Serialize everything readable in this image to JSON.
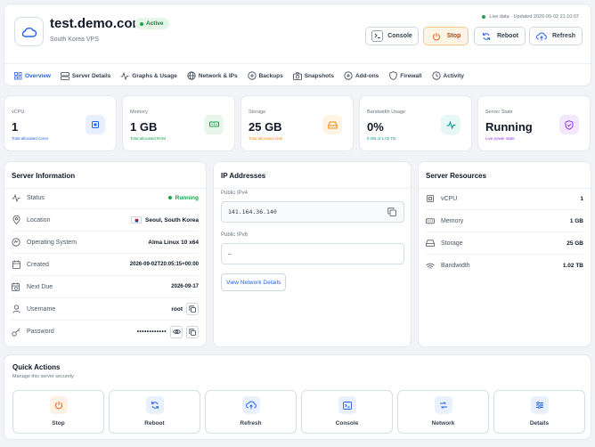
{
  "header": {
    "server_name": "test.demo.com",
    "status_badge": "Active",
    "subtitle": "South Korea VPS",
    "live_text": "Live data · Updated 2026-09-02 21:10:07",
    "buttons": {
      "console": "Console",
      "stop": "Stop",
      "reboot": "Reboot",
      "refresh": "Refresh"
    }
  },
  "tabs": [
    "Overview",
    "Server Details",
    "Graphs & Usage",
    "Network & IPs",
    "Backups",
    "Snapshots",
    "Add-ons",
    "Firewall",
    "Activity"
  ],
  "stats": [
    {
      "label": "vCPU",
      "value": "1",
      "sub": "Total allocated cores",
      "color": "#2563eb",
      "bg": "#e8f0fe"
    },
    {
      "label": "Memory",
      "value": "1 GB",
      "sub": "Total allocated RAM",
      "color": "#16a34a",
      "bg": "#e7f7ec"
    },
    {
      "label": "Storage",
      "value": "25 GB",
      "sub": "Total allocated disk",
      "color": "#ea8a0c",
      "bg": "#fff3e3"
    },
    {
      "label": "Bandwidth Usage",
      "value": "0%",
      "sub": "0 GB of 1.02 TB",
      "color": "#0d9488",
      "bg": "#e6f7f5"
    },
    {
      "label": "Server State",
      "value": "Running",
      "sub": "Live power state",
      "color": "#9333ea",
      "bg": "#f3e8fd"
    }
  ],
  "server_info": {
    "title": "Server Information",
    "rows": [
      {
        "label": "Status",
        "value": "Running"
      },
      {
        "label": "Location",
        "value": "Seoul, South Korea"
      },
      {
        "label": "Operating System",
        "value": "Alma Linux 10 x64"
      },
      {
        "label": "Created",
        "value": "2026-09-02T20:05:15+00:00"
      },
      {
        "label": "Next Due",
        "value": "2026-09-17"
      },
      {
        "label": "Username",
        "value": "root"
      },
      {
        "label": "Password",
        "value": "••••••••••••"
      }
    ]
  },
  "ip": {
    "title": "IP Addresses",
    "ipv4_label": "Public IPv4",
    "ipv4": "141.164.36.140",
    "ipv6_label": "Public IPv6",
    "ipv6": "—",
    "button": "View Network Details"
  },
  "resources": {
    "title": "Server Resources",
    "rows": [
      {
        "label": "vCPU",
        "value": "1"
      },
      {
        "label": "Memory",
        "value": "1 GB"
      },
      {
        "label": "Storage",
        "value": "25 GB"
      },
      {
        "label": "Bandwidth",
        "value": "1.02 TB"
      }
    ]
  },
  "quick_actions": {
    "title": "Quick Actions",
    "subtitle": "Manage this server securely",
    "items": [
      "Stop",
      "Reboot",
      "Refresh",
      "Console",
      "Network",
      "Details"
    ]
  },
  "colors": {
    "accent": "#2563eb",
    "running": "#16a34a",
    "stop": "#ea580c"
  }
}
